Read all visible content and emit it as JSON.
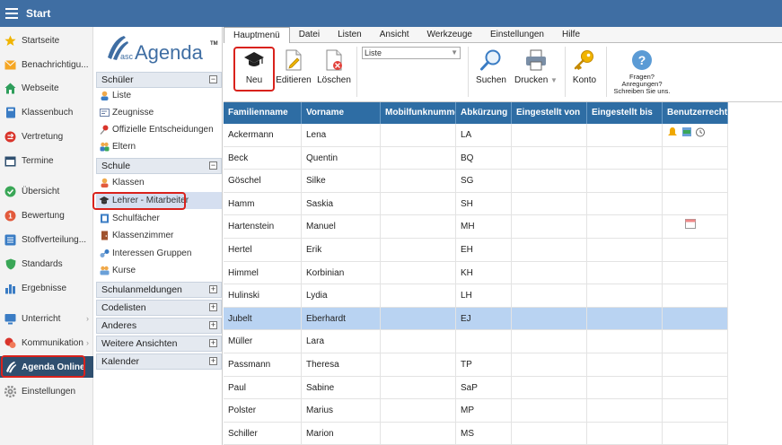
{
  "app": {
    "title": "Start"
  },
  "leftnav": {
    "items": [
      {
        "label": "Startseite",
        "icon": "star-icon",
        "color": "#f0b400"
      },
      {
        "label": "Benachrichtigu...",
        "icon": "envelope-icon",
        "color": "#f5a623"
      },
      {
        "label": "Webseite",
        "icon": "home-icon",
        "color": "#2e9e5b"
      },
      {
        "label": "Klassenbuch",
        "icon": "book-icon",
        "color": "#3a7cc4"
      },
      {
        "label": "Vertretung",
        "icon": "swap-icon",
        "color": "#d9342b"
      },
      {
        "label": "Termine",
        "icon": "calendar-icon",
        "color": "#2f4f6f"
      },
      {
        "label": "Übersicht",
        "icon": "check-circle-icon",
        "color": "#3aa757"
      },
      {
        "label": "Bewertung",
        "icon": "grade-icon",
        "color": "#e25a3c"
      },
      {
        "label": "Stoffverteilung...",
        "icon": "list-icon",
        "color": "#3a7cc4"
      },
      {
        "label": "Standards",
        "icon": "shield-icon",
        "color": "#3aa757"
      },
      {
        "label": "Ergebnisse",
        "icon": "bar-chart-icon",
        "color": "#3a7cc4"
      },
      {
        "label": "Unterricht",
        "icon": "monitor-icon",
        "color": "#3a7cc4"
      },
      {
        "label": "Kommunikation",
        "icon": "chat-icon",
        "color": "#d9342b"
      },
      {
        "label": "Agenda Online",
        "icon": "agenda-icon",
        "color": "#ffffff"
      },
      {
        "label": "Einstellungen",
        "icon": "gear-icon",
        "color": "#8a8a8a"
      }
    ]
  },
  "logo": {
    "text_small": "asc",
    "text_big": "Agenda",
    "tm": "TM"
  },
  "midpanel": {
    "schueler": {
      "title": "Schüler",
      "items": [
        "Liste",
        "Zeugnisse",
        "Offizielle Entscheidungen",
        "Eltern"
      ]
    },
    "schule": {
      "title": "Schule",
      "items": [
        "Klassen",
        "Lehrer - Mitarbeiter",
        "Schulfächer",
        "Klassenzimmer",
        "Interessen Gruppen",
        "Kurse"
      ]
    },
    "collapsed": [
      "Schulanmeldungen",
      "Codelisten",
      "Anderes",
      "Weitere Ansichten",
      "Kalender"
    ]
  },
  "menu": {
    "tabs": [
      "Hauptmenü",
      "Datei",
      "Listen",
      "Ansicht",
      "Werkzeuge",
      "Einstellungen",
      "Hilfe"
    ]
  },
  "ribbon": {
    "neu": "Neu",
    "editieren": "Editieren",
    "loeschen": "Löschen",
    "list_value": "Liste",
    "suchen": "Suchen",
    "drucken": "Drucken",
    "konto": "Konto",
    "help1": "Fragen?",
    "help2": "Anregungen?",
    "help3": "Schreiben Sie uns."
  },
  "table": {
    "headers": [
      "Familienname",
      "Vorname",
      "Mobilfunknummer",
      "Abkürzung",
      "Eingestellt von",
      "Eingestellt bis",
      "Benutzerrechte"
    ],
    "rows": [
      [
        "Ackermann",
        "Lena",
        "",
        "LA",
        "",
        "",
        ""
      ],
      [
        "Beck",
        "Quentin",
        "",
        "BQ",
        "",
        "",
        ""
      ],
      [
        "Göschel",
        "Silke",
        "",
        "SG",
        "",
        "",
        ""
      ],
      [
        "Hamm",
        "Saskia",
        "",
        "SH",
        "",
        "",
        ""
      ],
      [
        "Hartenstein",
        "Manuel",
        "",
        "MH",
        "",
        "",
        ""
      ],
      [
        "Hertel",
        "Erik",
        "",
        "EH",
        "",
        "",
        ""
      ],
      [
        "Himmel",
        "Korbinian",
        "",
        "KH",
        "",
        "",
        ""
      ],
      [
        "Hulinski",
        "Lydia",
        "",
        "LH",
        "",
        "",
        ""
      ],
      [
        "Jubelt",
        "Eberhardt",
        "",
        "EJ",
        "",
        "",
        ""
      ],
      [
        "Müller",
        "Lara",
        "",
        "",
        "",
        "",
        ""
      ],
      [
        "Passmann",
        "Theresa",
        "",
        "TP",
        "",
        "",
        ""
      ],
      [
        "Paul",
        "Sabine",
        "",
        "SaP",
        "",
        "",
        ""
      ],
      [
        "Polster",
        "Marius",
        "",
        "MP",
        "",
        "",
        ""
      ],
      [
        "Schiller",
        "Marion",
        "",
        "MS",
        "",
        "",
        ""
      ]
    ],
    "selected_row": 8
  }
}
